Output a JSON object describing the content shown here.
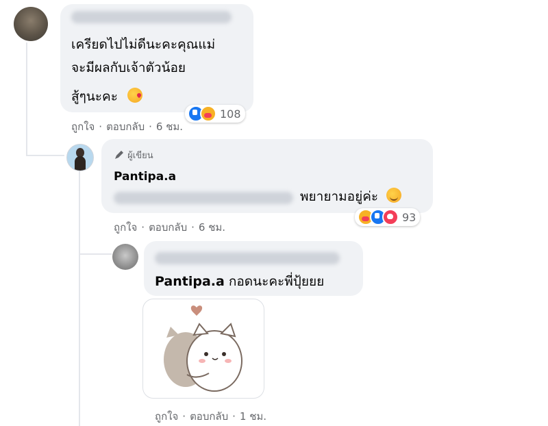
{
  "comment1": {
    "line1": "เครียดไปไม่ดีนะคะคุณแม่",
    "line2": "จะมีผลกับเจ้าตัวน้อย",
    "line3": "สู้ๆนะคะ",
    "reaction_count": "108",
    "actions": {
      "like": "ถูกใจ",
      "reply": "ตอบกลับ",
      "time": "6 ชม."
    }
  },
  "comment2": {
    "badge": "ผู้เขียน",
    "author": "Pantipa.a",
    "text": "พยายามอยู่ค่ะ",
    "reaction_count": "93",
    "actions": {
      "like": "ถูกใจ",
      "reply": "ตอบกลับ",
      "time": "6 ชม."
    }
  },
  "comment3": {
    "mention": "Pantipa.a",
    "text": "กอดนะคะพี่ปุ้ยยย",
    "sticker": "hugging-cats-sticker",
    "actions": {
      "like": "ถูกใจ",
      "reply": "ตอบกลับ",
      "time": "1 ชม."
    }
  },
  "separator": "·",
  "colors": {
    "bubble": "#f0f2f5",
    "meta": "#65676b",
    "like": "#1877f2",
    "love": "#f33e58",
    "care": "#f7b125"
  }
}
